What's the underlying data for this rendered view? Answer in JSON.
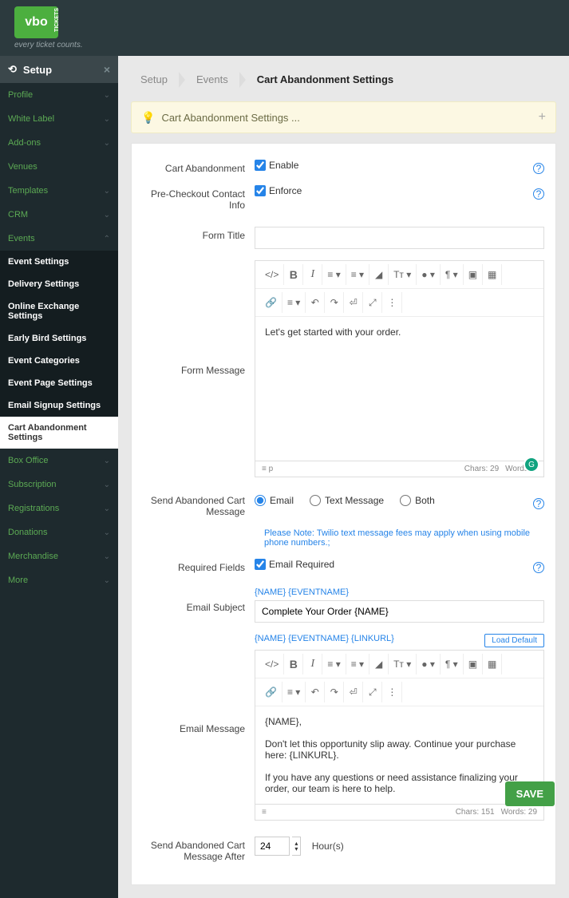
{
  "logo": {
    "text": "vbo",
    "vertical": "TICKETS",
    "tagline": "every ticket counts."
  },
  "sidebar": {
    "header": "Setup",
    "items": [
      {
        "label": "Profile",
        "chev": "⌄"
      },
      {
        "label": "White Label",
        "chev": "⌄"
      },
      {
        "label": "Add-ons",
        "chev": "⌄"
      },
      {
        "label": "Venues",
        "chev": ""
      },
      {
        "label": "Templates",
        "chev": "⌄"
      },
      {
        "label": "CRM",
        "chev": "⌄"
      },
      {
        "label": "Events",
        "chev": "⌃"
      }
    ],
    "events_sub": [
      {
        "label": "Event Settings"
      },
      {
        "label": "Delivery Settings"
      },
      {
        "label": "Online Exchange Settings"
      },
      {
        "label": "Early Bird Settings"
      },
      {
        "label": "Event Categories"
      },
      {
        "label": "Event Page Settings"
      },
      {
        "label": "Email Signup Settings"
      },
      {
        "label": "Cart Abandonment Settings",
        "active": true
      }
    ],
    "items2": [
      {
        "label": "Box Office",
        "chev": "⌄"
      },
      {
        "label": "Subscription",
        "chev": "⌄"
      },
      {
        "label": "Registrations",
        "chev": "⌄"
      },
      {
        "label": "Donations",
        "chev": "⌄"
      },
      {
        "label": "Merchandise",
        "chev": "⌄"
      },
      {
        "label": "More",
        "chev": "⌄"
      }
    ]
  },
  "breadcrumb": [
    "Setup",
    "Events",
    "Cart Abandonment Settings"
  ],
  "infobar": "Cart Abandonment Settings ...",
  "form": {
    "cart_abandonment_label": "Cart Abandonment",
    "enable_label": "Enable",
    "precheckout_label": "Pre-Checkout Contact Info",
    "enforce_label": "Enforce",
    "form_title_label": "Form Title",
    "form_message_label": "Form Message",
    "editor_text": "Let's get started with your order.",
    "status_left": "≡   p",
    "status_chars": "Chars: 29",
    "status_words": "Words: 6",
    "send_msg_label": "Send Abandoned Cart Message",
    "radio_email": "Email",
    "radio_text": "Text Message",
    "radio_both": "Both",
    "note": "Please Note: Twilio text message fees may apply when using mobile phone numbers.;",
    "required_fields_label": "Required Fields",
    "email_required_label": "Email Required",
    "email_subject_label": "Email Subject",
    "subject_tokens": "{NAME} {EVENTNAME}",
    "subject_value": "Complete Your Order {NAME}",
    "email_message_label": "Email Message",
    "message_tokens": "{NAME} {EVENTNAME} {LINKURL}",
    "load_default": "Load Default",
    "msg_p1": "{NAME},",
    "msg_p2": "Don't let this opportunity slip away. Continue your purchase here: {LINKURL}.",
    "msg_p3": "If you have any questions or need assistance finalizing your order, our team is here to help.",
    "status2_chars": "Chars: 151",
    "status2_words": "Words: 29",
    "send_after_label": "Send Abandoned Cart Message After",
    "after_value": "24",
    "after_unit": "Hour(s)"
  },
  "save": "SAVE",
  "icons": {
    "gear": "⚙",
    "code": "</>",
    "bold": "B",
    "italic": "I",
    "list": "≡",
    "listn": "≡",
    "eraser": "◢",
    "fontsize": "Tт",
    "drop": "●",
    "para": "¶",
    "image": "▣",
    "table": "▦",
    "link": "🔗",
    "align": "≡",
    "undo": "↶",
    "redo": "↷",
    "expand": "⤢",
    "line": "⏎",
    "more": "⋮"
  }
}
